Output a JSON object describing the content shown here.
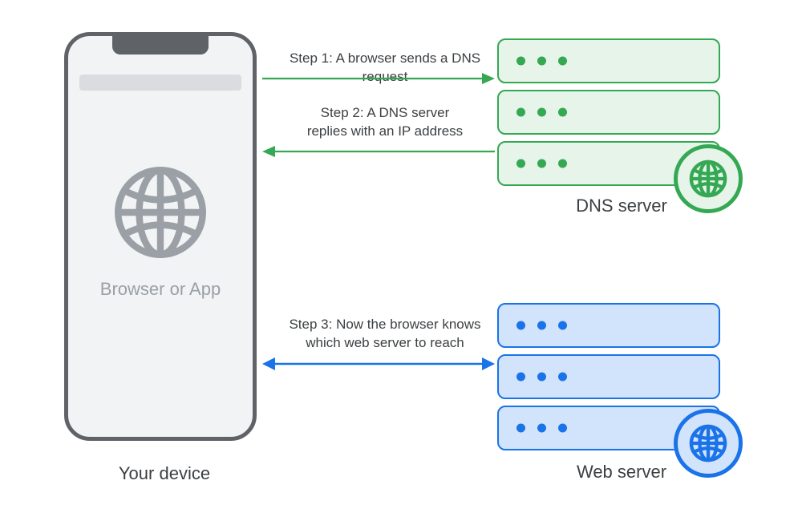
{
  "device": {
    "app_label": "Browser or App",
    "caption": "Your device"
  },
  "dns_server": {
    "caption": "DNS server"
  },
  "web_server": {
    "caption": "Web server"
  },
  "steps": {
    "s1": "Step 1: A browser sends a DNS request",
    "s2_line1": "Step 2: A DNS server",
    "s2_line2": "replies with an IP address",
    "s3_line1": "Step 3: Now the browser knows",
    "s3_line2": "which web server to reach"
  },
  "colors": {
    "dns": "#34A853",
    "web": "#1A73E8",
    "phone": "#5F6368",
    "phone_icon": "#9AA0A6"
  }
}
